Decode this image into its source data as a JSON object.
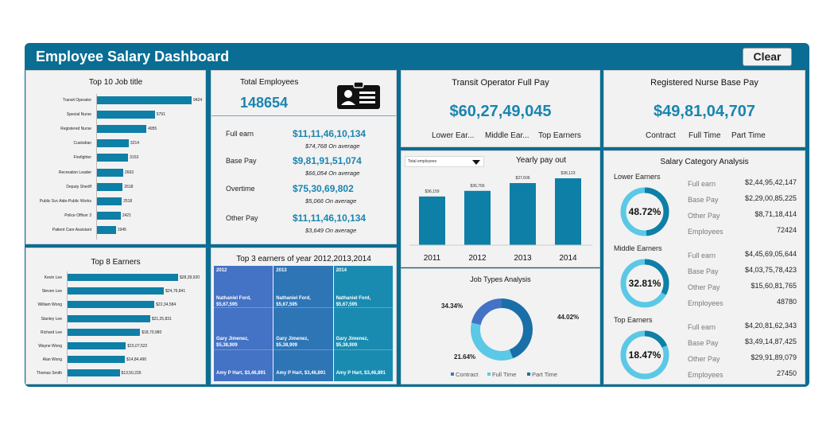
{
  "header": {
    "title": "Employee Salary Dashboard",
    "clear_label": "Clear"
  },
  "top_jobs": {
    "title": "Top 10 Job title",
    "chart_data": {
      "type": "bar",
      "orientation": "horizontal",
      "categories": [
        "Transit Operator",
        "Special Nurse",
        "Registered Nurse",
        "Custodian",
        "Firefighter",
        "Recreation Leader",
        "Deputy Sheriff",
        "Public Svc Aide-Public Works",
        "Police Officer 3",
        "Patient Care Assistant"
      ],
      "values": [
        9424,
        5791,
        4955,
        3214,
        3153,
        2663,
        2618,
        2518,
        2421,
        1945
      ],
      "labels": [
        "9424",
        "5791",
        "4955",
        "3214",
        "3153",
        "2663",
        "2618",
        "2518",
        "2421",
        "1945"
      ],
      "xlim": [
        0,
        9424
      ]
    }
  },
  "top_earners": {
    "title": "Top 8 Earners",
    "chart_data": {
      "type": "bar",
      "orientation": "horizontal",
      "categories": [
        "Kevin Lee",
        "Steven Lee",
        "William Wong",
        "Stanley Lee",
        "Richard Lee",
        "Wayne Wong",
        "Alan Wong",
        "Thomas Smith"
      ],
      "values": [
        2839920,
        2476841,
        2234584,
        2125831,
        1870980,
        1507522,
        1484490,
        1350226
      ],
      "labels": [
        "$28,39,920",
        "$24,76,841",
        "$22,34,584",
        "$21,25,831",
        "$18,70,980",
        "$15,07,522",
        "$14,84,490",
        "$13,50,226"
      ],
      "xlim": [
        0,
        2839920
      ]
    }
  },
  "total_employees": {
    "title": "Total Employees",
    "value": "148654",
    "icon": "id-badge-icon",
    "rows": [
      {
        "label": "Full earn",
        "value": "$11,11,46,10,134",
        "avg": "$74,768",
        "avg_label": "On average"
      },
      {
        "label": "Base Pay",
        "value": "$9,81,91,51,074",
        "avg": "$66,054",
        "avg_label": "On average"
      },
      {
        "label": "Overtime",
        "value": "$75,30,69,802",
        "avg": "$5,066",
        "avg_label": "On average"
      },
      {
        "label": "Other Pay",
        "value": "$11,11,46,10,134",
        "avg": "$3,649",
        "avg_label": "On average"
      }
    ]
  },
  "top3": {
    "title": "Top 3 earners of year 2012,2013,2014",
    "years": [
      "2012",
      "2013",
      "2014"
    ],
    "colors": [
      "#4472c4",
      "#2e75b6",
      "#1a8bb0"
    ],
    "row1": [
      "Nathaniel Ford, $5,67,595",
      "Nathaniel Ford, $5,67,595",
      "Nathaniel Ford, $5,67,595"
    ],
    "row2": [
      "Gary Jimenez, $5,38,909",
      "Gary Jimenez, $5,38,909",
      "Gary Jimenez, $5,38,909"
    ],
    "row3": [
      "Amy P Hart, $3,46,891",
      "Amy P Hart, $3,46,891",
      "Amy P Hart, $3,46,891"
    ]
  },
  "transit": {
    "title": "Transit Operator Full Pay",
    "value": "$60,27,49,045",
    "links": [
      "Lower Ear...",
      "Middle Ear...",
      "Top Earners"
    ]
  },
  "nurse": {
    "title": "Registered Nurse Base Pay",
    "value": "$49,81,04,707",
    "links": [
      "Contract",
      "Full Time",
      "Part Time"
    ]
  },
  "yearly": {
    "title": "Yearly pay out",
    "dropdown": "Total employees",
    "chart_data": {
      "type": "bar",
      "categories": [
        "2011",
        "2012",
        "2013",
        "2014"
      ],
      "values": [
        36159,
        36766,
        37606,
        38123
      ],
      "labels": [
        "$36,159",
        "$36,766",
        "$37,606",
        "$38,123"
      ],
      "ylim": [
        34000,
        38123
      ]
    }
  },
  "job_types": {
    "title": "Job Types Analysis",
    "chart_data": {
      "type": "pie",
      "donut": true,
      "categories": [
        "Contract",
        "Full Time",
        "Part Time"
      ],
      "values": [
        21.64,
        34.34,
        44.02
      ],
      "labels": [
        "21.64%",
        "34.34%",
        "44.02%"
      ],
      "colors": [
        "#4472c4",
        "#5bc8e6",
        "#1a6fa8"
      ],
      "legend": "bottom"
    }
  },
  "salary_cat": {
    "title": "Salary Category Analysis",
    "groups": [
      {
        "name": "Lower Earners",
        "pct": "48.72%",
        "fraction": 0.4872,
        "rows": [
          [
            "Full earn",
            "$2,44,95,42,147"
          ],
          [
            "Base Pay",
            "$2,29,00,85,225"
          ],
          [
            "Other Pay",
            "$8,71,18,414"
          ],
          [
            "Employees",
            "72424"
          ]
        ]
      },
      {
        "name": "Middle Earners",
        "pct": "32.81%",
        "fraction": 0.3281,
        "rows": [
          [
            "Full earn",
            "$4,45,69,05,644"
          ],
          [
            "Base Pay",
            "$4,03,75,78,423"
          ],
          [
            "Other Pay",
            "$15,60,81,765"
          ],
          [
            "Employees",
            "48780"
          ]
        ]
      },
      {
        "name": "Top Earners",
        "pct": "18.47%",
        "fraction": 0.1847,
        "rows": [
          [
            "Full earn",
            "$4,20,81,62,343"
          ],
          [
            "Base Pay",
            "$3,49,14,87,425"
          ],
          [
            "Other Pay",
            "$29,91,89,079"
          ],
          [
            "Employees",
            "27450"
          ]
        ]
      }
    ],
    "ring_colors": [
      "#0e7fa6",
      "#5bc8e6"
    ]
  }
}
